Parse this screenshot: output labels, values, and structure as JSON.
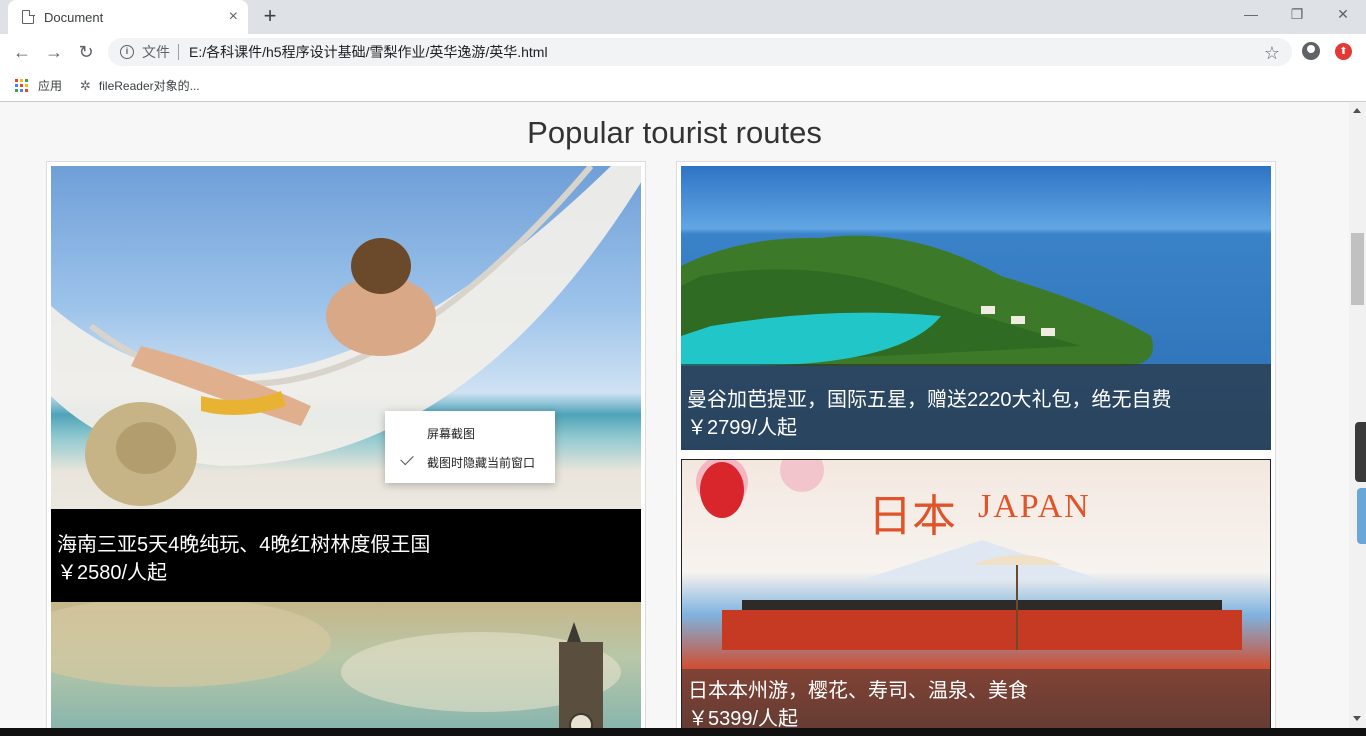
{
  "browser": {
    "tab_title": "Document",
    "tab_close": "×",
    "new_tab": "+",
    "url_scheme_label": "文件",
    "url": "E:/各科课件/h5程序设计基础/雪梨作业/英华逸游/英华.html",
    "bookmarks": [
      {
        "label": "应用",
        "icon": "apps-icon"
      },
      {
        "label": "fileReader对象的...",
        "icon": "gear-icon"
      }
    ]
  },
  "page": {
    "title": "Popular tourist routes",
    "cards": [
      {
        "title": "海南三亚5天4晚纯玩、4晚红树林度假王国",
        "price": "￥2580/人起"
      },
      {
        "title": "曼谷加芭提亚，国际五星，赠送2220大礼包，绝无自费",
        "price": "￥2799/人起"
      },
      {
        "title": "日本本州游，樱花、寿司、温泉、美食",
        "price": "￥5399/人起"
      }
    ],
    "japan_banner": {
      "kanji": "日本",
      "latin": "JAPAN"
    }
  },
  "context_menu": {
    "items": [
      "屏幕截图",
      "截图时隐藏当前窗口"
    ]
  },
  "colors": {
    "caption_dark": "#000000",
    "caption_translucent": "rgba(40,40,40,0.6)",
    "page_bg": "#f7f7f7"
  }
}
